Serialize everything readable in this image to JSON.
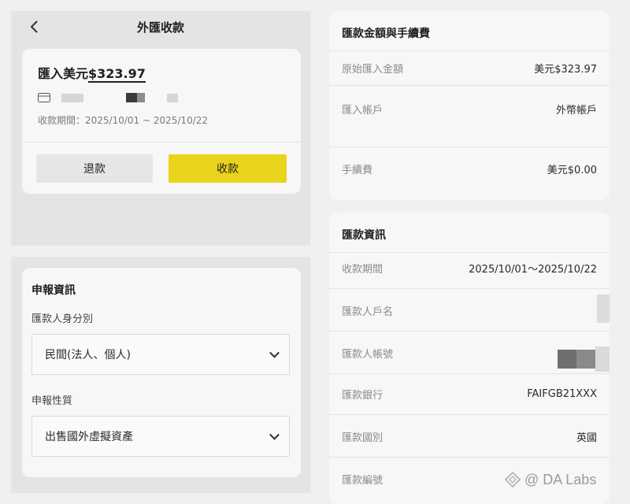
{
  "header": {
    "title": "外匯收款"
  },
  "summary": {
    "amount_prefix": "匯入美元",
    "amount": "$323.97",
    "period": "收款期間：2025/10/01 ~ 2025/10/22",
    "refund_label": "退款",
    "collect_label": "收款"
  },
  "declaration": {
    "title": "申報資訊",
    "identity_label": "匯款人身分別",
    "identity_value": "民間(法人、個人)",
    "nature_label": "申報性質",
    "nature_value": "出售國外虛擬資產"
  },
  "fees": {
    "title": "匯款金額與手續費",
    "rows": [
      {
        "label": "原始匯入金額",
        "value": "美元$323.97"
      },
      {
        "label": "匯入帳戶",
        "value": "外幣帳戶"
      },
      {
        "label": "手續費",
        "value": "美元$0.00"
      }
    ]
  },
  "remit_info": {
    "title": "匯款資訊",
    "rows": [
      {
        "label": "收款期間",
        "value": "2025/10/01～2025/10/22"
      },
      {
        "label": "匯款人戶名",
        "value": ""
      },
      {
        "label": "匯款人帳號",
        "value": ""
      },
      {
        "label": "匯款銀行",
        "value": "FAIFGB21XXX"
      },
      {
        "label": "匯款國別",
        "value": "英國"
      },
      {
        "label": "匯款編號",
        "value": ""
      }
    ]
  },
  "watermark": {
    "text": "@ DA Labs"
  },
  "colors": {
    "accent_yellow": "#e9d41c",
    "background": "#f0f0f0",
    "card": "#f7f7f7"
  }
}
